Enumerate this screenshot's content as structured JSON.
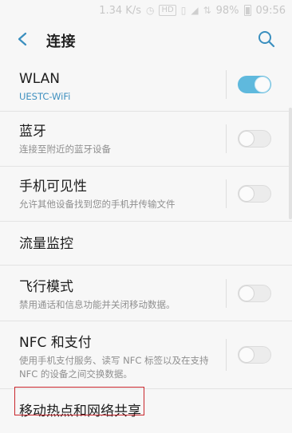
{
  "status_bar": {
    "speed": "1.34 K/s",
    "hd_badge": "HD",
    "battery": "98%",
    "time": "09:56"
  },
  "header": {
    "title": "连接"
  },
  "items": [
    {
      "title": "WLAN",
      "subtitle": "UESTC-WiFi",
      "toggle": "on"
    },
    {
      "title": "蓝牙",
      "subtitle": "连接至附近的蓝牙设备",
      "toggle": "off"
    },
    {
      "title": "手机可见性",
      "subtitle": "允许其他设备找到您的手机并传输文件",
      "toggle": "off"
    },
    {
      "title": "流量监控"
    },
    {
      "title": "飞行模式",
      "subtitle": "禁用通话和信息功能并关闭移动数据。",
      "toggle": "off"
    },
    {
      "title": "NFC 和支付",
      "subtitle_line1": "使用手机支付服务、读写 NFC 标签以及在支持",
      "subtitle_line2": "NFC 的设备之间交换数据。",
      "toggle": "off"
    },
    {
      "title": "移动热点和网络共享"
    }
  ],
  "colors": {
    "accent": "#5fb9dd",
    "highlight": "#c9262c"
  },
  "icons": {
    "back": "back-arrow-icon",
    "search": "search-icon"
  }
}
